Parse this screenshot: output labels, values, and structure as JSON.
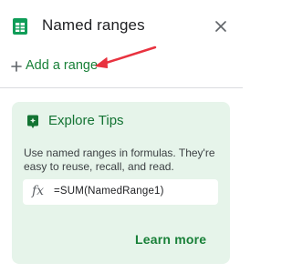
{
  "header": {
    "title": "Named ranges",
    "app_icon": "sheets-icon",
    "close_icon": "close-icon"
  },
  "actions": {
    "add_label": "Add a range",
    "add_icon": "plus-icon"
  },
  "annotation": {
    "arrow_color": "#e8323f",
    "arrow_icon": "annotation-arrow"
  },
  "tips": {
    "title": "Explore Tips",
    "icon": "tips-icon",
    "body": "Use named ranges in formulas. They're easy to reuse, recall, and read.",
    "formula_icon": "fx",
    "formula": "=SUM(NamedRange1)",
    "learn_more": "Learn more"
  },
  "colors": {
    "accent_green": "#188038",
    "card_background": "#e6f4ea",
    "sheets_green": "#0f9d58"
  }
}
